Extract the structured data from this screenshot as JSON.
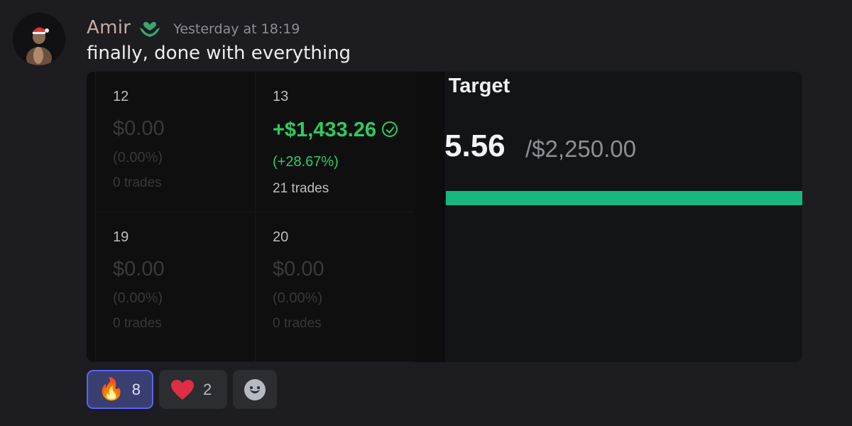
{
  "author": {
    "username": "Amir",
    "role_icon": "heart-hands-icon",
    "avatar_icon": "avatar-image",
    "timestamp": "Yesterday at 18:19"
  },
  "message": {
    "text": "finally, done with everything"
  },
  "attachment": {
    "target": {
      "title": "t Target",
      "value": "5.56",
      "total": "/$2,250.00",
      "progress": 1.0,
      "progress_color": "#17b87f"
    },
    "calendar": {
      "cells": [
        {
          "day": "12",
          "pnl": "$0.00",
          "pct": "(0.00%)",
          "trades": "0 trades"
        },
        {
          "day": "13",
          "pnl": "+$1,433.26",
          "pct": "(+28.67%)",
          "trades": "21 trades",
          "status_icon": "check-circle-icon",
          "color": "#2ccc63"
        },
        {
          "day": "19",
          "pnl": "$0.00",
          "pct": "(0.00%)",
          "trades": "0 trades"
        },
        {
          "day": "20",
          "pnl": "$0.00",
          "pct": "(0.00%)",
          "trades": "0 trades"
        }
      ]
    }
  },
  "reactions": [
    {
      "emoji": "🔥",
      "icon": "fire-icon",
      "count": "8",
      "reacted": true
    },
    {
      "emoji": "❤️",
      "icon": "heart-icon",
      "count": "2",
      "reacted": false
    }
  ],
  "add_reaction_icon": "add-reaction-icon",
  "colors": {
    "background": "#1c1c21",
    "username": "#c9aaa2",
    "profit_green": "#2ccc63",
    "reacted_border": "#5865f2"
  }
}
